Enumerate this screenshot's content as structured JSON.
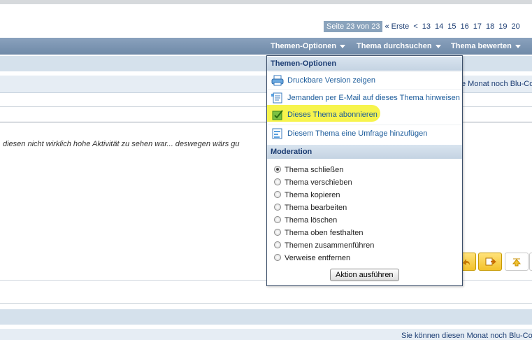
{
  "pagination": {
    "status": "Seite 23 von 23",
    "first": "« Erste",
    "prev": "<",
    "pages": [
      "13",
      "14",
      "15",
      "16",
      "17",
      "18",
      "19",
      "20"
    ]
  },
  "navbar": {
    "items": [
      "Themen-Optionen",
      "Thema durchsuchen",
      "Thema bewerten"
    ]
  },
  "background": {
    "band_text_top": "e Monat noch Blu-Co",
    "snippet": "diesen nicht wirklich hohe Aktivität zu sehen war... deswegen wärs gu",
    "band_text_bottom": "Sie können diesen Monat noch Blu-Co"
  },
  "dropdown": {
    "header": "Themen-Optionen",
    "items": [
      {
        "label": "Druckbare Version zeigen",
        "icon": "printer-icon"
      },
      {
        "label": "Jemanden per E-Mail auf dieses Thema hinweisen",
        "icon": "email-icon"
      },
      {
        "label": "Dieses Thema abonnieren",
        "icon": "subscribe-icon"
      },
      {
        "label": "Diesem Thema eine Umfrage hinzufügen",
        "icon": "poll-icon"
      }
    ],
    "moderation_header": "Moderation",
    "moderation_options": [
      "Thema schließen",
      "Thema verschieben",
      "Thema kopieren",
      "Thema bearbeiten",
      "Thema löschen",
      "Thema oben festhalten",
      "Themen zusammenführen",
      "Verweise entfernen"
    ],
    "moderation_selected": "Thema schließen",
    "action_button": "Aktion ausführen"
  },
  "colors": {
    "navbar": "#7a93b0",
    "link": "#1c5c9b",
    "highlight": "#f7f44d"
  }
}
